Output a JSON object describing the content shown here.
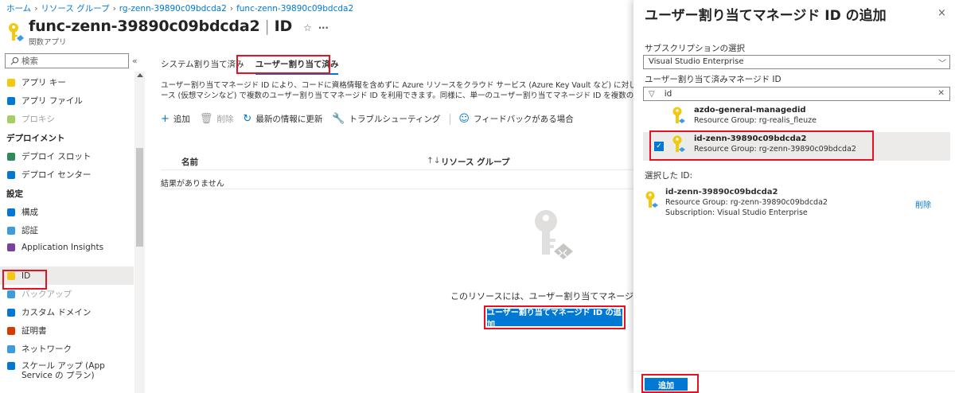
{
  "breadcrumb": [
    "ホーム",
    "リソース グループ",
    "rg-zenn-39890c09bdcda2",
    "func-zenn-39890c09bdcda2"
  ],
  "header": {
    "resource_name": "func-zenn-39890c09bdcda2",
    "separator": "|",
    "page_name": "ID",
    "subtitle": "関数アプリ",
    "star": "☆",
    "more": "···"
  },
  "sidebar": {
    "search_placeholder": "検索",
    "collapse": "«",
    "items_top": [
      {
        "label": "アプリ キー",
        "icon": "key-icon",
        "color": "#f2c811"
      },
      {
        "label": "アプリ ファイル",
        "icon": "file-icon",
        "color": "#0078d4"
      },
      {
        "label": "プロキシ",
        "icon": "proxy-icon",
        "color": "#a4cf62",
        "dim": true
      }
    ],
    "section_deploy": "デプロイメント",
    "items_deploy": [
      {
        "label": "デプロイ スロット",
        "icon": "slot-icon",
        "color": "#2e8b57"
      },
      {
        "label": "デプロイ センター",
        "icon": "cube-icon",
        "color": "#0078d4"
      }
    ],
    "section_settings": "設定",
    "items_settings": [
      {
        "label": "構成",
        "icon": "config-icon",
        "color": "#0078d4"
      },
      {
        "label": "認証",
        "icon": "person-icon",
        "color": "#3b9cde"
      },
      {
        "label": "Application Insights",
        "icon": "insights-icon",
        "color": "#7b3fa0"
      },
      {
        "label": "ID",
        "icon": "identity-key-icon",
        "color": "#f2c811",
        "active": true
      },
      {
        "label": "バックアップ",
        "icon": "cloud-icon",
        "color": "#3b9cde",
        "dim": true
      },
      {
        "label": "カスタム ドメイン",
        "icon": "domain-icon",
        "color": "#0078d4"
      },
      {
        "label": "証明書",
        "icon": "certificate-icon",
        "color": "#d83b01"
      },
      {
        "label": "ネットワーク",
        "icon": "network-icon",
        "color": "#3b9cde"
      },
      {
        "label": "スケール アップ (App Service の プラン)",
        "icon": "scale-icon",
        "color": "#0078d4"
      }
    ]
  },
  "main": {
    "tabs": [
      {
        "label": "システム割り当て済み",
        "selected": false
      },
      {
        "label": "ユーザー割り当て済み",
        "selected": true
      }
    ],
    "description": [
      "ユーザー割り当てマネージド ID により、コードに資格情報を含めずに Azure リソースをクラウド サービス (Azure Key Vault など) に対して認証できます。この種類",
      "ース (仮想マシンなど) で複数のユーザー割り当てマネージド ID を利用できます。同様に、単一のユーザー割り当てマネージド ID を複数のリソース (仮想マシンなど)"
    ],
    "toolbar": {
      "add": "追加",
      "delete": "削除",
      "refresh": "最新の情報に更新",
      "troubleshoot": "トラブルシューティング",
      "feedback": "フィードバックがある場合"
    },
    "table": {
      "col_name": "名前",
      "sort": "↑↓",
      "col_rg": "リソース グループ",
      "no_results": "結果がありません"
    },
    "empty_message": "このリソースには、ユーザー割り当てマネージド ID が見つ",
    "add_button": "ユーザー割り当てマネージド ID の追加"
  },
  "panel": {
    "title": "ユーザー割り当てマネージド ID の追加",
    "close": "×",
    "subscription_label": "サブスクリプションの選択",
    "subscription_value": "Visual Studio Enterprise",
    "identity_label": "ユーザー割り当て済みマネージド ID",
    "filter_value": "id",
    "identities": [
      {
        "name": "azdo-general-managedid",
        "rg": "Resource Group: rg-realis_fleuze",
        "selected": false
      },
      {
        "name": "id-zenn-39890c09bdcda2",
        "rg": "Resource Group: rg-zenn-39890c09bdcda2",
        "selected": true
      }
    ],
    "selected_label": "選択した ID:",
    "selected": {
      "name": "id-zenn-39890c09bdcda2",
      "rg": "Resource Group: rg-zenn-39890c09bdcda2",
      "subscription": "Subscription: Visual Studio Enterprise",
      "remove": "削除"
    },
    "add_button": "追加"
  },
  "colors": {
    "accent": "#0078d4",
    "highlight": "#e81123",
    "key_yellow": "#f2c811"
  }
}
